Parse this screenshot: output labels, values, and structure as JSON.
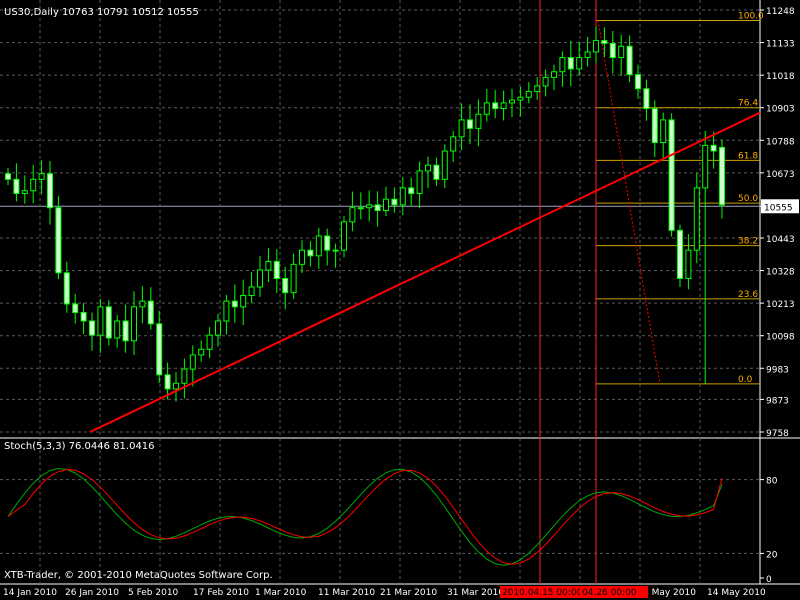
{
  "header": {
    "symbol_info": "US30,Daily  10763 10791 10512 10555",
    "stoch_label": "Stoch(5,3,3) 76.0446 81.0416",
    "copyright": "XTB-Trader, © 2001-2010 MetaQuotes Software Corp."
  },
  "colors": {
    "background": "#000000",
    "grid": "#5a5a5a",
    "candle_bull": "#000000",
    "candle_bear": "#ccffcc",
    "candle_wick": "#00ff00",
    "trendline": "#ff0000",
    "fibo": "#c8a000",
    "fibo_label": "#ffaa00",
    "stoch_main": "#00aa00",
    "stoch_signal": "#ff0000",
    "axis_text": "#ffffff",
    "price_line": "#a0a0c0"
  },
  "chart_data": [
    {
      "type": "candlestick",
      "title": "US30,Daily",
      "ohlc_last": {
        "open": 10763,
        "high": 10791,
        "low": 10512,
        "close": 10555
      },
      "ylim": [
        9758,
        11248
      ],
      "y_ticks": [
        11248,
        11133,
        11018,
        10903,
        10788,
        10673,
        10555,
        10443,
        10328,
        10213,
        10098,
        9983,
        9873,
        9758
      ],
      "current_price": 10555,
      "x_ticks": [
        "14 Jan 2010",
        "26 Jan 2010",
        "5 Feb 2010",
        "17 Feb 2010",
        "1 Mar 2010",
        "11 Mar 2010",
        "21 Mar 2010",
        "31 Mar 2010",
        "4 May 2010",
        "14 May 2010"
      ],
      "x_highlight_labels": [
        "2010.04.15 00:00",
        "04.26 00:00"
      ],
      "closes": [
        10650,
        10600,
        10610,
        10650,
        10670,
        10550,
        10320,
        10210,
        10180,
        10150,
        10100,
        10200,
        10090,
        10150,
        10080,
        10200,
        10220,
        10140,
        9960,
        9910,
        9930,
        9980,
        10030,
        10050,
        10100,
        10150,
        10220,
        10200,
        10240,
        10270,
        10330,
        10360,
        10300,
        10250,
        10350,
        10400,
        10380,
        10450,
        10400,
        10400,
        10500,
        10550,
        10550,
        10560,
        10540,
        10580,
        10560,
        10620,
        10600,
        10680,
        10700,
        10650,
        10750,
        10800,
        10860,
        10830,
        10880,
        10920,
        10900,
        10920,
        10930,
        10940,
        10960,
        10980,
        11010,
        11030,
        11080,
        11040,
        11080,
        11100,
        11140,
        11130,
        11080,
        11120,
        11020,
        10970,
        10900,
        10780,
        10860,
        10470,
        10300,
        10400,
        10620,
        10770,
        10750,
        10560
      ],
      "stochastic": {
        "params": "Stoch(5,3,3)",
        "main": 76.0446,
        "signal": 81.0416,
        "ylim": [
          0,
          100
        ],
        "levels": [
          80,
          20
        ],
        "y_ticks": [
          80,
          20,
          0
        ]
      },
      "fibonacci": {
        "levels": [
          {
            "label": "100.0",
            "price": 11211
          },
          {
            "label": "76.4",
            "price": 10903
          },
          {
            "label": "61.8",
            "price": 10717
          },
          {
            "label": "50.0",
            "price": 10566
          },
          {
            "label": "38.2",
            "price": 10416
          },
          {
            "label": "23.6",
            "price": 10228
          },
          {
            "label": "0.0",
            "price": 9928
          }
        ]
      }
    }
  ]
}
